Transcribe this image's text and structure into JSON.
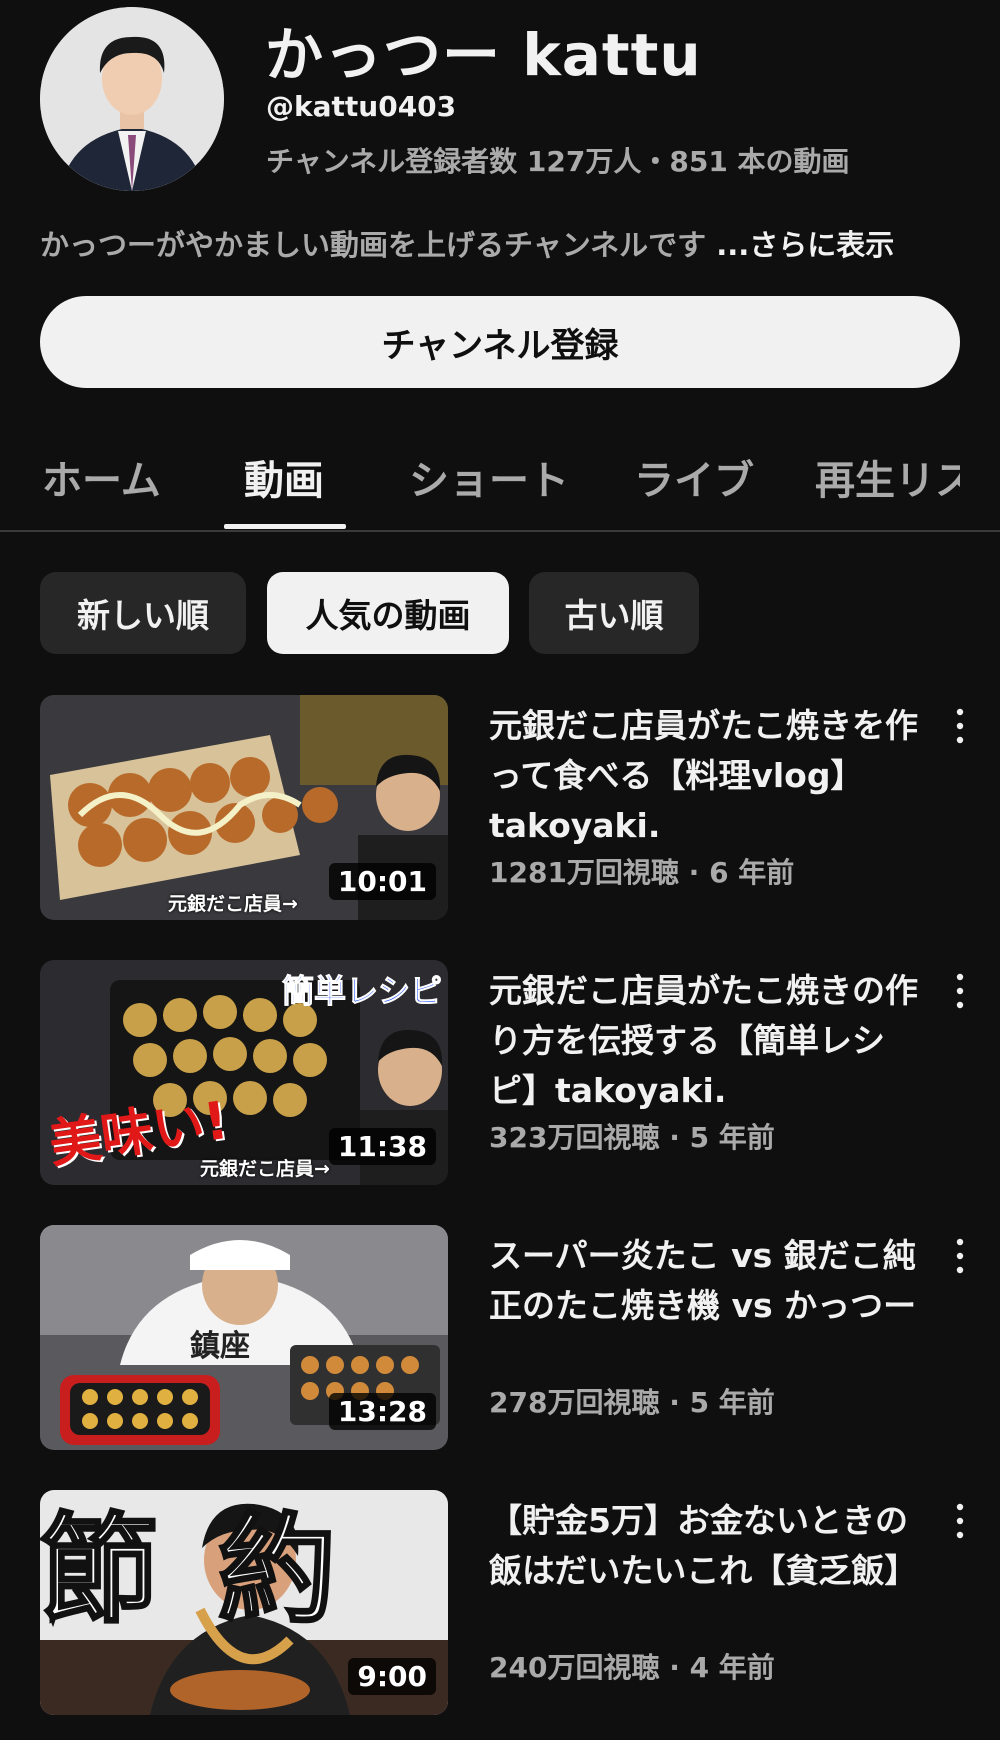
{
  "channel": {
    "name": "かっつー kattu",
    "handle": "@kattu0403",
    "stats": "チャンネル登録者数 127万人・851 本の動画",
    "description": "かっつーがやかましい動画を上げるチャンネルです ",
    "more_label": "...さらに表示",
    "avatar_icon": "channel-avatar"
  },
  "subscribe_label": "チャンネル登録",
  "tabs": [
    {
      "label": "ホーム",
      "active": false
    },
    {
      "label": "動画",
      "active": true
    },
    {
      "label": "ショート",
      "active": false
    },
    {
      "label": "ライブ",
      "active": false
    },
    {
      "label": "再生リス",
      "active": false
    }
  ],
  "chips": [
    {
      "label": "新しい順",
      "active": false
    },
    {
      "label": "人気の動画",
      "active": true
    },
    {
      "label": "古い順",
      "active": false
    }
  ],
  "videos": [
    {
      "title": "元銀だこ店員がたこ焼きを作って食べる【料理vlog】takoyaki.",
      "meta": "1281万回視聴 · 6 年前",
      "duration": "10:01",
      "thumb_caption": "元銀だこ店員→"
    },
    {
      "title": "元銀だこ店員がたこ焼きの作り方を伝授する【簡単レシピ】takoyaki.",
      "meta": "323万回視聴 · 5 年前",
      "duration": "11:38",
      "thumb_caption": "元銀だこ店員→",
      "thumb_banner": "簡単レシピ",
      "thumb_big": "美味い!"
    },
    {
      "title": "スーパー炎たこ vs 銀だこ純正のたこ焼き機 vs かっつー",
      "meta": "278万回視聴 · 5 年前",
      "duration": "13:28",
      "thumb_shirt": "鎮座"
    },
    {
      "title": "【貯金5万】お金ないときの飯はだいたいこれ【貧乏飯】",
      "meta": "240万回視聴 · 4 年前",
      "duration": "9:00",
      "thumb_big": "節約"
    }
  ],
  "colors": {
    "background": "#0f0f0f",
    "chip_bg": "#272727",
    "text_secondary": "#aaaaaa"
  }
}
